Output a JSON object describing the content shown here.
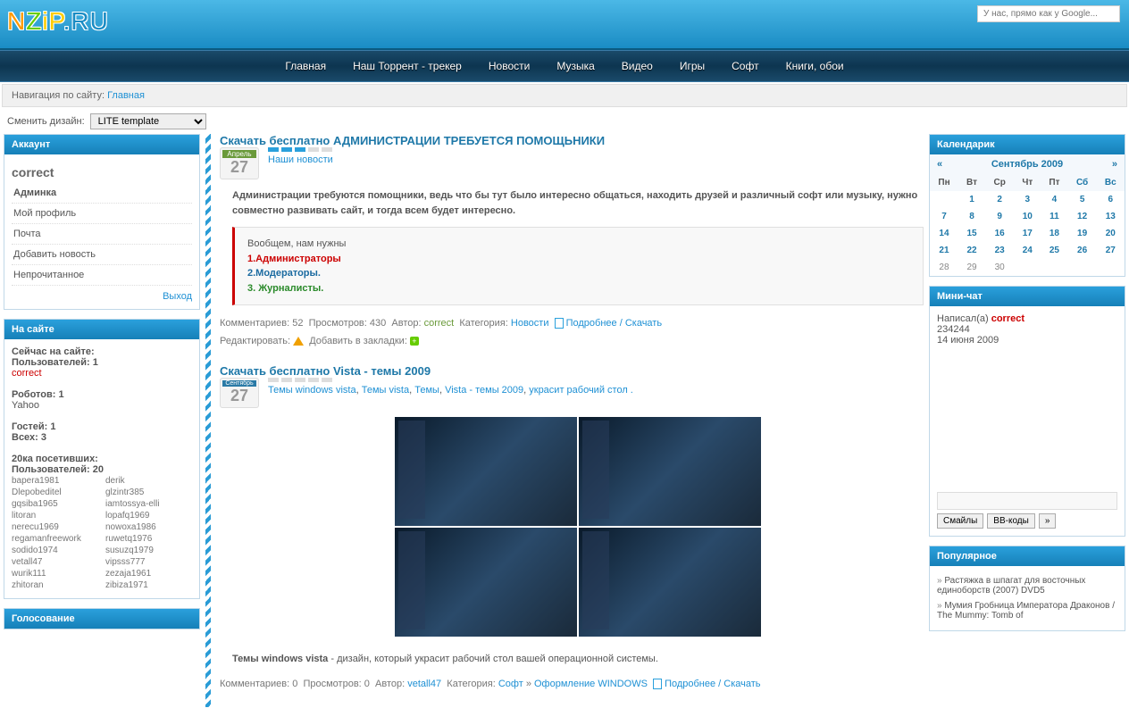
{
  "site": {
    "logo": "NZIP.RU",
    "search_hint": "У нас, прямо как у Google..."
  },
  "nav": [
    "Главная",
    "Наш Торрент - трекер",
    "Новости",
    "Музыка",
    "Видео",
    "Игры",
    "Софт",
    "Книги, обои"
  ],
  "breadcrumb": {
    "label": "Навигация по сайту:",
    "current": "Главная"
  },
  "design": {
    "label": "Сменить дизайн:",
    "value": "LITE template"
  },
  "account": {
    "title": "Аккаунт",
    "user": "correct",
    "items": [
      "Админка",
      "Мой профиль",
      "Почта",
      "Добавить новость",
      "Непрочитанное"
    ],
    "logout": "Выход"
  },
  "online": {
    "title": "На сайте",
    "now_label": "Сейчас на сайте:",
    "users_label": "Пользователей: 1",
    "user": "correct",
    "robots_label": "Роботов: 1",
    "robot": "Yahoo",
    "guests_label": "Гостей: 1",
    "total_label": "Всех: 3",
    "top20_label": "20ка посетивших:",
    "top20_count": "Пользователей: 20",
    "col1": [
      "bapera1981",
      "Dlepobeditel",
      "gqsiba1965",
      "litoran",
      "nerecu1969",
      "regamanfreework",
      "sodido1974",
      "vetall47",
      "wurik111",
      "zhitoran"
    ],
    "col2": [
      "derik",
      "glzintr385",
      "iamtossya-elli",
      "lopafq1969",
      "nowoxa1986",
      "ruwetq1976",
      "susuzq1979",
      "vipsss777",
      "zezaja1961",
      "zibiza1971"
    ]
  },
  "vote": {
    "title": "Голосование"
  },
  "posts": [
    {
      "title": "Скачать бесплатно АДМИНИСТРАЦИИ ТРЕБУЕТСЯ ПОМОЩЬНИКИ",
      "month": "Апрель",
      "day": "27",
      "cats": [
        "Наши новости"
      ],
      "content_bold": "Администрации требуются помощники, ведь что бы тут было интересно общаться, находить друзей и различный софт или музыку, нужно совместно развивать сайт, и тогда всем будет интересно.",
      "quote_intro": "Вообщем, нам нужны",
      "quote_line1": "1.Администраторы",
      "quote_line2": "2.Модераторы.",
      "quote_line3": "3. Журналисты.",
      "meta": {
        "comments": "Комментариев: 52",
        "views": "Просмотров: 430",
        "author_lbl": "Автор:",
        "author": "correct",
        "cat_lbl": "Категория:",
        "cat": "Новости",
        "more": "Подробнее / Скачать",
        "edit_lbl": "Редактировать:",
        "bookmark_lbl": "Добавить в закладки:"
      }
    },
    {
      "title": "Скачать бесплатно Vista - темы 2009",
      "month": "Сентябрь",
      "day": "27",
      "cats": [
        "Темы windows vista",
        "Темы vista",
        "Темы",
        "Vista - темы 2009",
        "украсит рабочий стол ."
      ],
      "desc_bold": "Темы windows vista",
      "desc_rest": " - дизайн, который украсит рабочий стол вашей операционной системы.",
      "meta": {
        "comments": "Комментариев: 0",
        "views": "Просмотров: 0",
        "author_lbl": "Автор:",
        "author": "vetall47",
        "cat_lbl": "Категория:",
        "cat": "Софт",
        "subcat": "Оформление WINDOWS",
        "more": "Подробнее / Скачать"
      }
    }
  ],
  "calendar": {
    "title": "Календарик",
    "prev": "«",
    "next": "»",
    "month": "Сентябрь 2009",
    "dow": [
      "Пн",
      "Вт",
      "Ср",
      "Чт",
      "Пт",
      "Сб",
      "Вс"
    ],
    "weeks": [
      [
        "",
        "1",
        "2",
        "3",
        "4",
        "5",
        "6"
      ],
      [
        "7",
        "8",
        "9",
        "10",
        "11",
        "12",
        "13"
      ],
      [
        "14",
        "15",
        "16",
        "17",
        "18",
        "19",
        "20"
      ],
      [
        "21",
        "22",
        "23",
        "24",
        "25",
        "26",
        "27"
      ],
      [
        "28",
        "29",
        "30",
        "",
        "",
        "",
        ""
      ]
    ],
    "plain_days": [
      "28",
      "29",
      "30"
    ]
  },
  "chat": {
    "title": "Мини-чат",
    "wrote_lbl": "Написал(а)",
    "author": "correct",
    "msg": "234244",
    "date": "14 июня 2009",
    "btn_smiles": "Смайлы",
    "btn_bb": "ВВ-коды",
    "btn_go": "»"
  },
  "popular": {
    "title": "Популярное",
    "items": [
      "Растяжка в шпагат для восточных единоборств (2007) DVD5",
      "Мумия Гробница Императора Драконов / The Mummy: Tomb of"
    ]
  }
}
